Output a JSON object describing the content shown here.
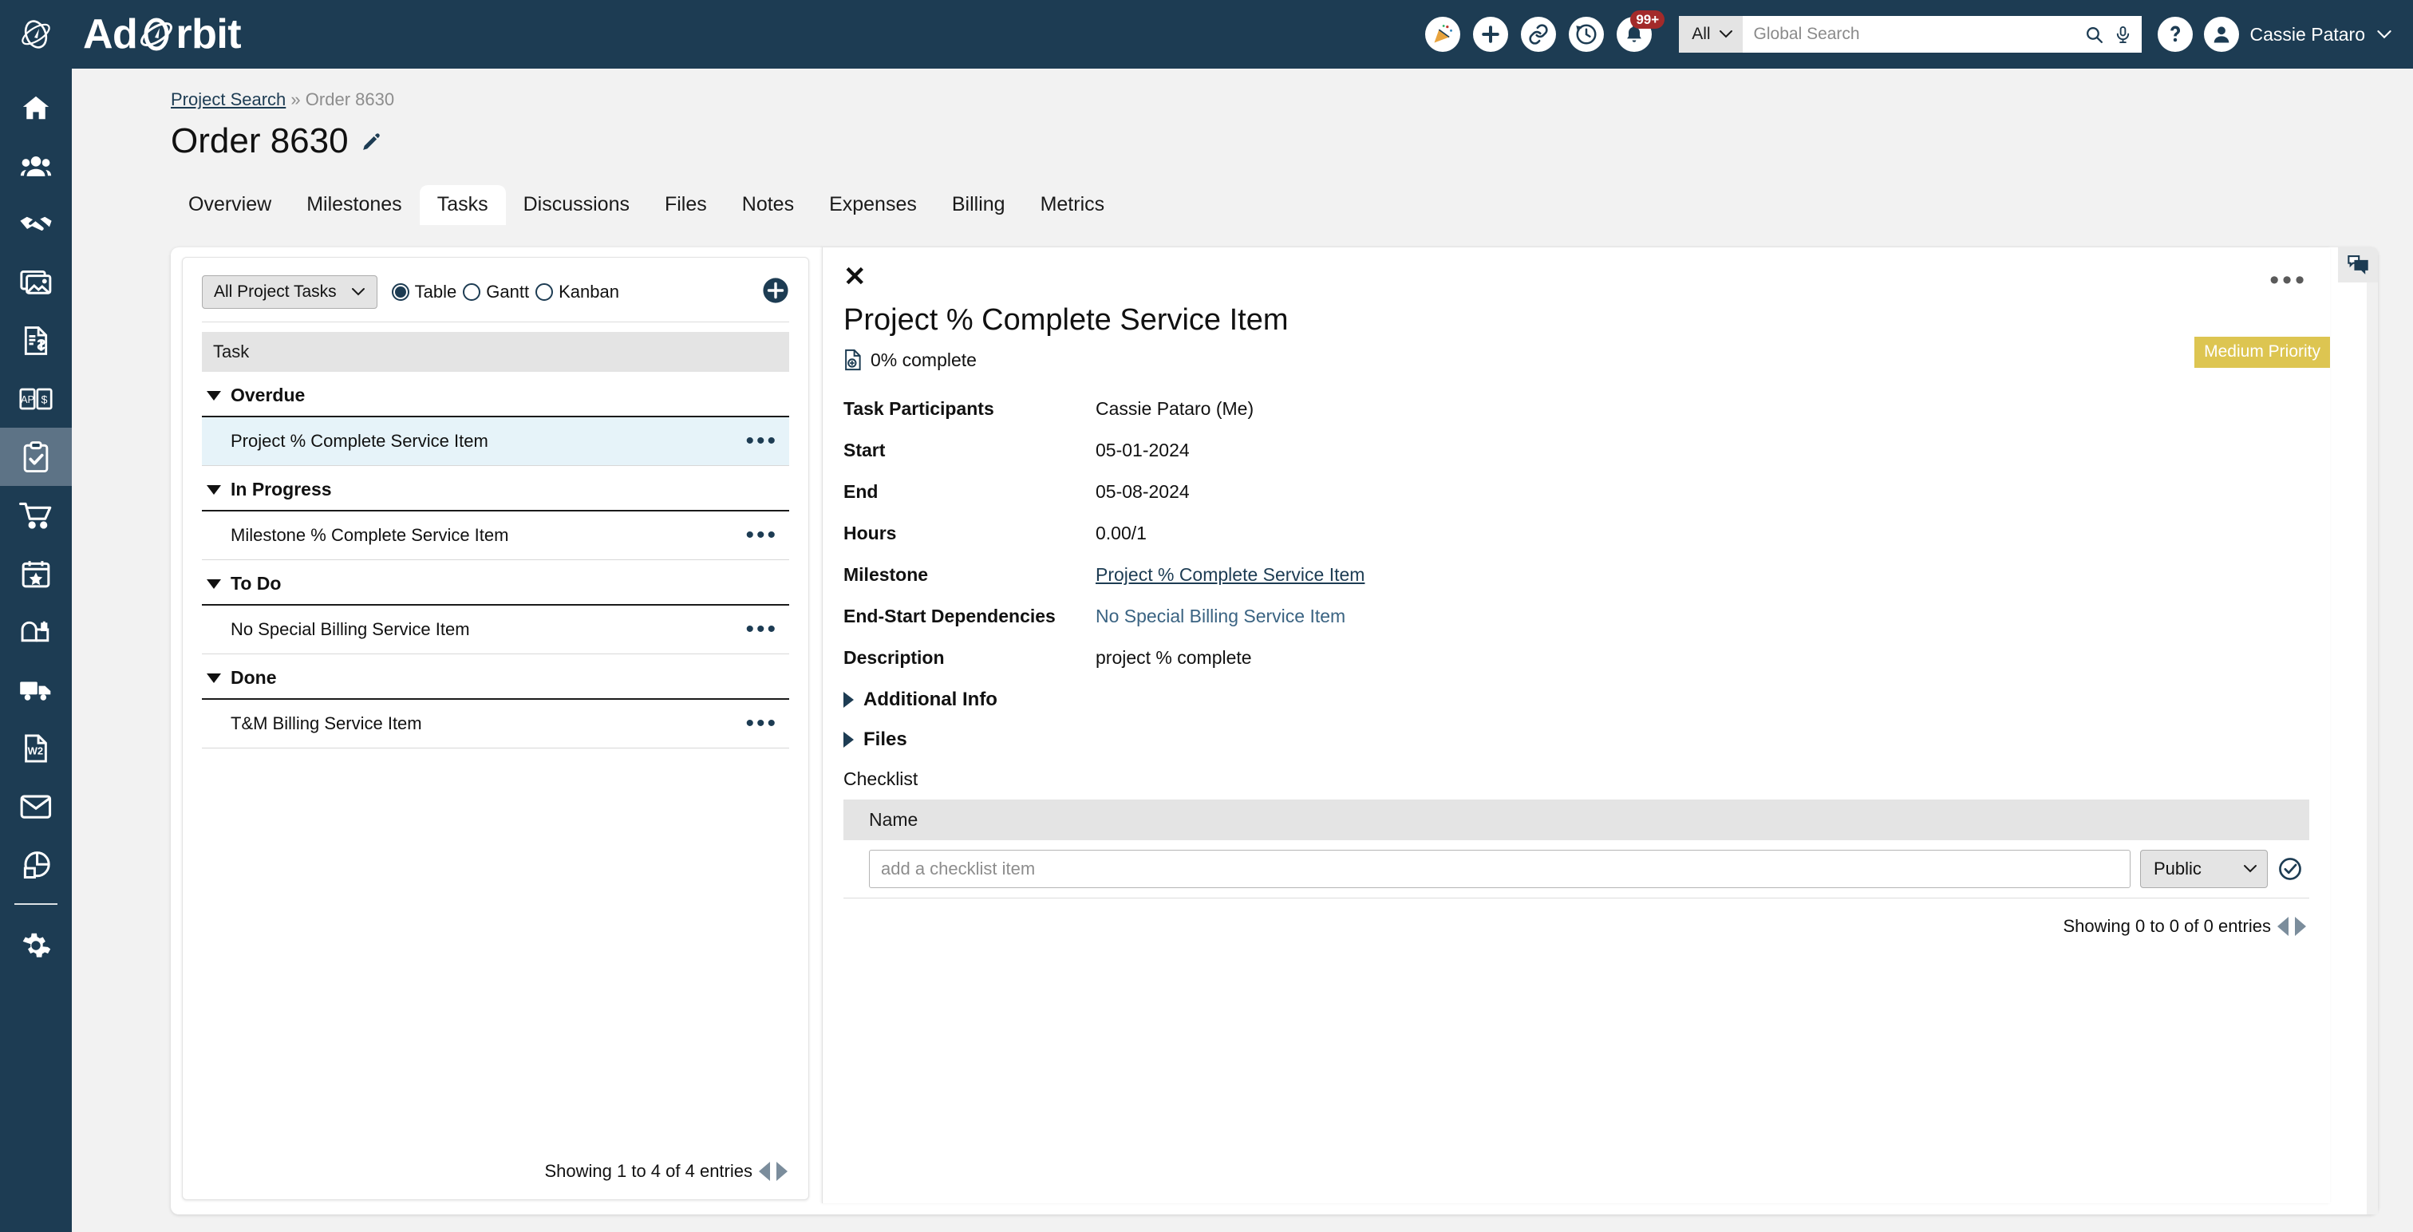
{
  "app": {
    "brand_prefix": "Ad",
    "brand_suffix": "rbit",
    "logo_icon": "orbit-rocket-icon"
  },
  "topbar": {
    "icons": [
      {
        "name": "celebrate-icon",
        "label": "Celebrate"
      },
      {
        "name": "add-icon",
        "label": "Add"
      },
      {
        "name": "link-icon",
        "label": "Link"
      },
      {
        "name": "history-icon",
        "label": "Recent"
      },
      {
        "name": "bell-icon",
        "label": "Notifications"
      }
    ],
    "notification_count": "99+",
    "search_scope": "All",
    "search_placeholder": "Global Search",
    "search_value": "",
    "help_label": "Help",
    "user_name": "Cassie Pataro"
  },
  "sidebar": {
    "items": [
      {
        "name": "sidebar-item-home",
        "icon": "home-icon",
        "active": false
      },
      {
        "name": "sidebar-item-contacts",
        "icon": "people-icon",
        "active": false
      },
      {
        "name": "sidebar-item-deals",
        "icon": "handshake-icon",
        "active": false
      },
      {
        "name": "sidebar-item-media",
        "icon": "photos-icon",
        "active": false
      },
      {
        "name": "sidebar-item-invoices",
        "icon": "invoice-dollar-icon",
        "active": false
      },
      {
        "name": "sidebar-item-ap-ar",
        "icon": "ap-dollar-book-icon",
        "active": false
      },
      {
        "name": "sidebar-item-projects",
        "icon": "clipboard-check-icon",
        "active": true
      },
      {
        "name": "sidebar-item-orders",
        "icon": "shopping-cart-icon",
        "active": false
      },
      {
        "name": "sidebar-item-events",
        "icon": "calendar-star-icon",
        "active": false
      },
      {
        "name": "sidebar-item-campaigns",
        "icon": "mailbox-icon",
        "active": false
      },
      {
        "name": "sidebar-item-shipping",
        "icon": "truck-icon",
        "active": false
      },
      {
        "name": "sidebar-item-w2",
        "icon": "w2-document-icon",
        "active": false
      },
      {
        "name": "sidebar-item-email",
        "icon": "envelope-icon",
        "active": false
      },
      {
        "name": "sidebar-item-reports",
        "icon": "pie-chart-icon",
        "active": false
      },
      {
        "name": "sidebar-item-settings",
        "icon": "gear-icon",
        "active": false
      }
    ]
  },
  "breadcrumb": {
    "root_label": "Project Search",
    "separator": "»",
    "current_label": "Order 8630"
  },
  "page": {
    "title": "Order 8630",
    "edit_icon": "pencil-icon"
  },
  "tabs": [
    {
      "label": "Overview",
      "active": false
    },
    {
      "label": "Milestones",
      "active": false
    },
    {
      "label": "Tasks",
      "active": true
    },
    {
      "label": "Discussions",
      "active": false
    },
    {
      "label": "Files",
      "active": false
    },
    {
      "label": "Notes",
      "active": false
    },
    {
      "label": "Expenses",
      "active": false
    },
    {
      "label": "Billing",
      "active": false
    },
    {
      "label": "Metrics",
      "active": false
    }
  ],
  "task_panel": {
    "filter_select_value": "All Project Tasks",
    "view_options": [
      {
        "label": "Table",
        "selected": true
      },
      {
        "label": "Gantt",
        "selected": false
      },
      {
        "label": "Kanban",
        "selected": false
      }
    ],
    "add_button_label": "Add Task",
    "column_header": "Task",
    "groups": [
      {
        "label": "Overdue",
        "rows": [
          {
            "name": "Project % Complete Service Item",
            "selected": true
          }
        ]
      },
      {
        "label": "In Progress",
        "rows": [
          {
            "name": "Milestone % Complete Service Item",
            "selected": false
          }
        ]
      },
      {
        "label": "To Do",
        "rows": [
          {
            "name": "No Special Billing Service Item",
            "selected": false
          }
        ]
      },
      {
        "label": "Done",
        "rows": [
          {
            "name": "T&M Billing Service Item",
            "selected": false
          }
        ]
      }
    ],
    "footer_text": "Showing 1 to 4 of 4 entries"
  },
  "detail": {
    "close_label": "✕",
    "menu_label": "•••",
    "title": "Project % Complete Service Item",
    "complete_text": "0% complete",
    "complete_icon": "document-progress-icon",
    "priority_badge": "Medium Priority",
    "priority_color": "#ddc551",
    "fields": [
      {
        "label": "Task Participants",
        "value": "Cassie Pataro (Me)",
        "style": "plain"
      },
      {
        "label": "Start",
        "value": "05-01-2024",
        "style": "plain"
      },
      {
        "label": "End",
        "value": "05-08-2024",
        "style": "plain"
      },
      {
        "label": "Hours",
        "value": "0.00/1",
        "style": "plain"
      },
      {
        "label": "Milestone",
        "value": "Project % Complete Service Item",
        "style": "link-underline"
      },
      {
        "label": "End-Start Dependencies",
        "value": "No Special Billing Service Item",
        "style": "link-plain"
      },
      {
        "label": "Description",
        "value": "project % complete",
        "style": "plain"
      }
    ],
    "accordions": [
      {
        "label": "Additional Info",
        "expanded": false
      },
      {
        "label": "Files",
        "expanded": false
      }
    ],
    "checklist": {
      "section_label": "Checklist",
      "column_header": "Name",
      "input_placeholder": "add a checklist item",
      "input_value": "",
      "visibility_value": "Public",
      "confirm_icon": "check-circle-icon",
      "footer_text": "Showing 0 to 0 of 0 entries"
    },
    "chat_icon": "chat-bubbles-icon"
  }
}
